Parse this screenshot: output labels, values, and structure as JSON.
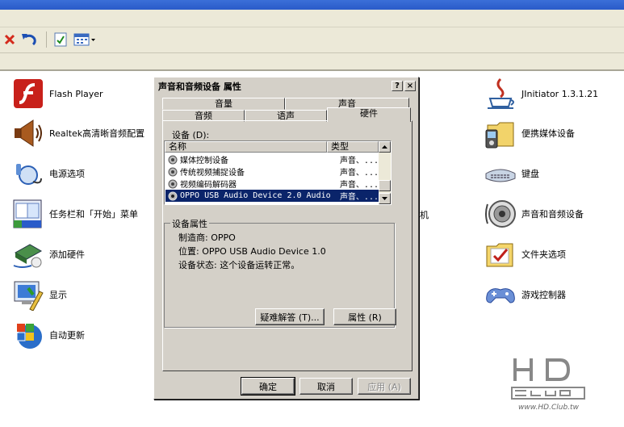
{
  "toolbar": {
    "icons": [
      "delete-icon",
      "undo-icon",
      "properties-icon",
      "views-icon"
    ]
  },
  "control_panel_left": [
    {
      "label": "Flash Player",
      "icon": "flash-player-icon"
    },
    {
      "label": "Realtek高清晰音频配置",
      "icon": "realtek-speaker-icon"
    },
    {
      "label": "电源选项",
      "icon": "power-options-icon"
    },
    {
      "label": "任务栏和「开始」菜单",
      "icon": "taskbar-start-menu-icon"
    },
    {
      "label": "添加硬件",
      "icon": "add-hardware-icon"
    },
    {
      "label": "显示",
      "icon": "display-icon"
    },
    {
      "label": "自动更新",
      "icon": "windows-update-icon"
    }
  ],
  "control_panel_right": [
    {
      "label": "JInitiator 1.3.1.21",
      "icon": "java-icon"
    },
    {
      "label": "便携媒体设备",
      "icon": "portable-media-icon"
    },
    {
      "label": "键盘",
      "icon": "keyboard-icon"
    },
    {
      "label": "声音和音频设备",
      "icon": "sound-audio-icon"
    },
    {
      "label": "文件夹选项",
      "icon": "folder-options-icon"
    },
    {
      "label": "游戏控制器",
      "icon": "game-controller-icon"
    }
  ],
  "hidden_fragment": "机",
  "dialog": {
    "title": "声音和音频设备 属性",
    "help_button": "?",
    "close_button": "×",
    "tabs_back": [
      "音量",
      "声音"
    ],
    "tabs_front": [
      "音频",
      "语声",
      "硬件"
    ],
    "devices_label": "设备 (D):",
    "col_name": "名称",
    "col_type": "类型",
    "devices": [
      {
        "name": "媒体控制设备",
        "type": "声音、..."
      },
      {
        "name": "传统视频捕捉设备",
        "type": "声音、..."
      },
      {
        "name": "视频编码解码器",
        "type": "声音、..."
      },
      {
        "name": "OPPO USB Audio Device 2.0 Audio",
        "type": "声音、..."
      }
    ],
    "group_label": "设备属性",
    "manufacturer": "制造商: OPPO",
    "location": "位置: OPPO USB Audio Device 1.0",
    "status": "设备状态: 这个设备运转正常。",
    "troubleshoot_button": "疑难解答 (T)...",
    "properties_button": "属性 (R)",
    "ok_button": "确定",
    "cancel_button": "取消",
    "apply_button": "应用 (A)"
  },
  "watermark": {
    "text": "HD CLUB",
    "url": "www.HD.Club.tw"
  }
}
